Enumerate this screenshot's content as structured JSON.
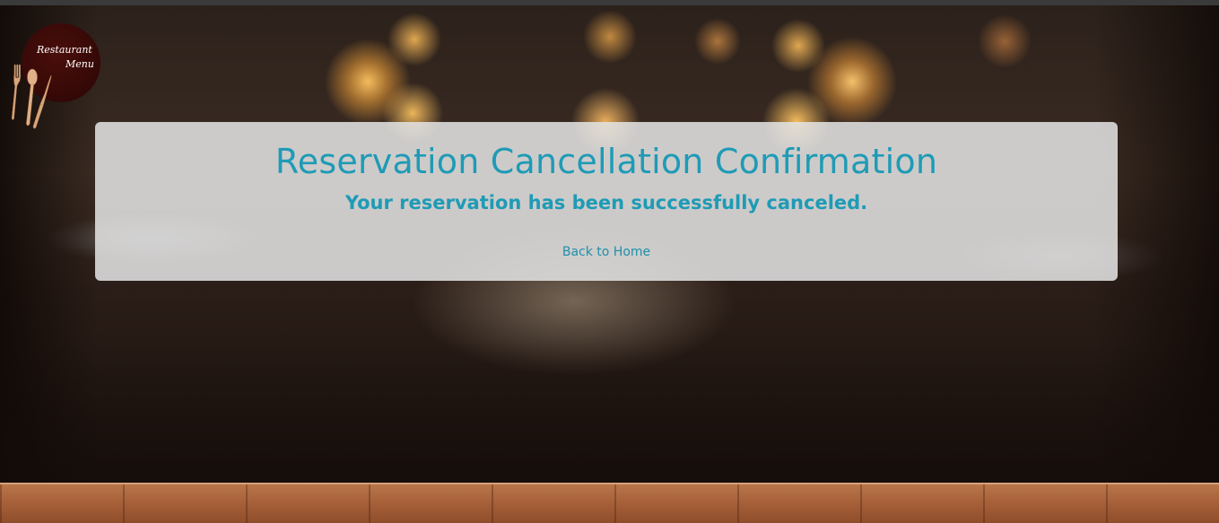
{
  "logo": {
    "line1": "Restaurant",
    "line2": "Menu"
  },
  "confirmation": {
    "title": "Reservation Cancellation Confirmation",
    "message": "Your reservation has been successfully canceled.",
    "back_link": "Back to Home"
  },
  "colors": {
    "accent": "#1e9bb6",
    "card_background": "#e1e1e1",
    "logo_background": "#3a0908"
  }
}
